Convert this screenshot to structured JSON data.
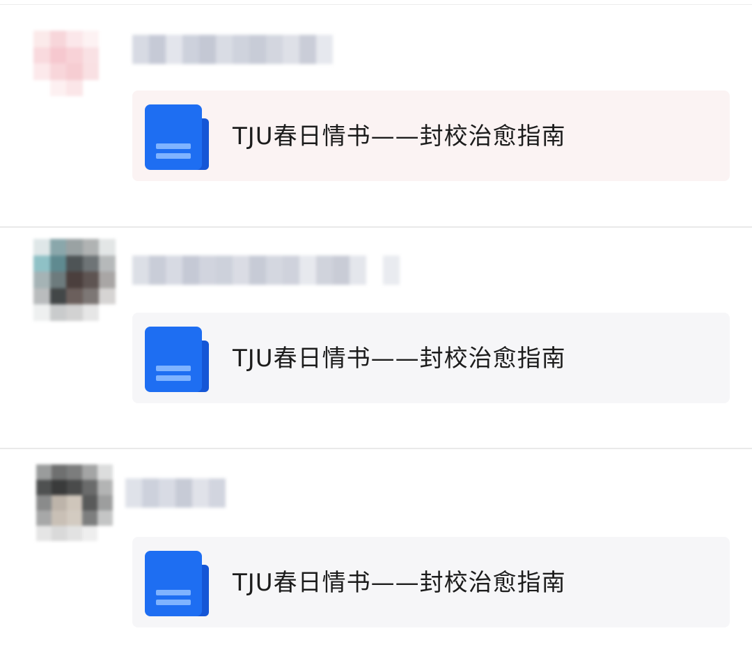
{
  "colors": {
    "doc_icon_main": "#1e6ef2",
    "doc_icon_fold": "#1556d6",
    "doc_icon_lines": "#7fb3ff",
    "card_bg": "#f6f6f8",
    "divider": "#e9e9e9"
  },
  "icons": {
    "shared_doc": "document-icon"
  },
  "posts": [
    {
      "author_hidden": true,
      "card": {
        "title": "TJU春日情书——封校治愈指南"
      }
    },
    {
      "author_hidden": true,
      "card": {
        "title": "TJU春日情书——封校治愈指南"
      }
    },
    {
      "author_hidden": true,
      "card": {
        "title": "TJU春日情书——封校治愈指南"
      }
    }
  ]
}
